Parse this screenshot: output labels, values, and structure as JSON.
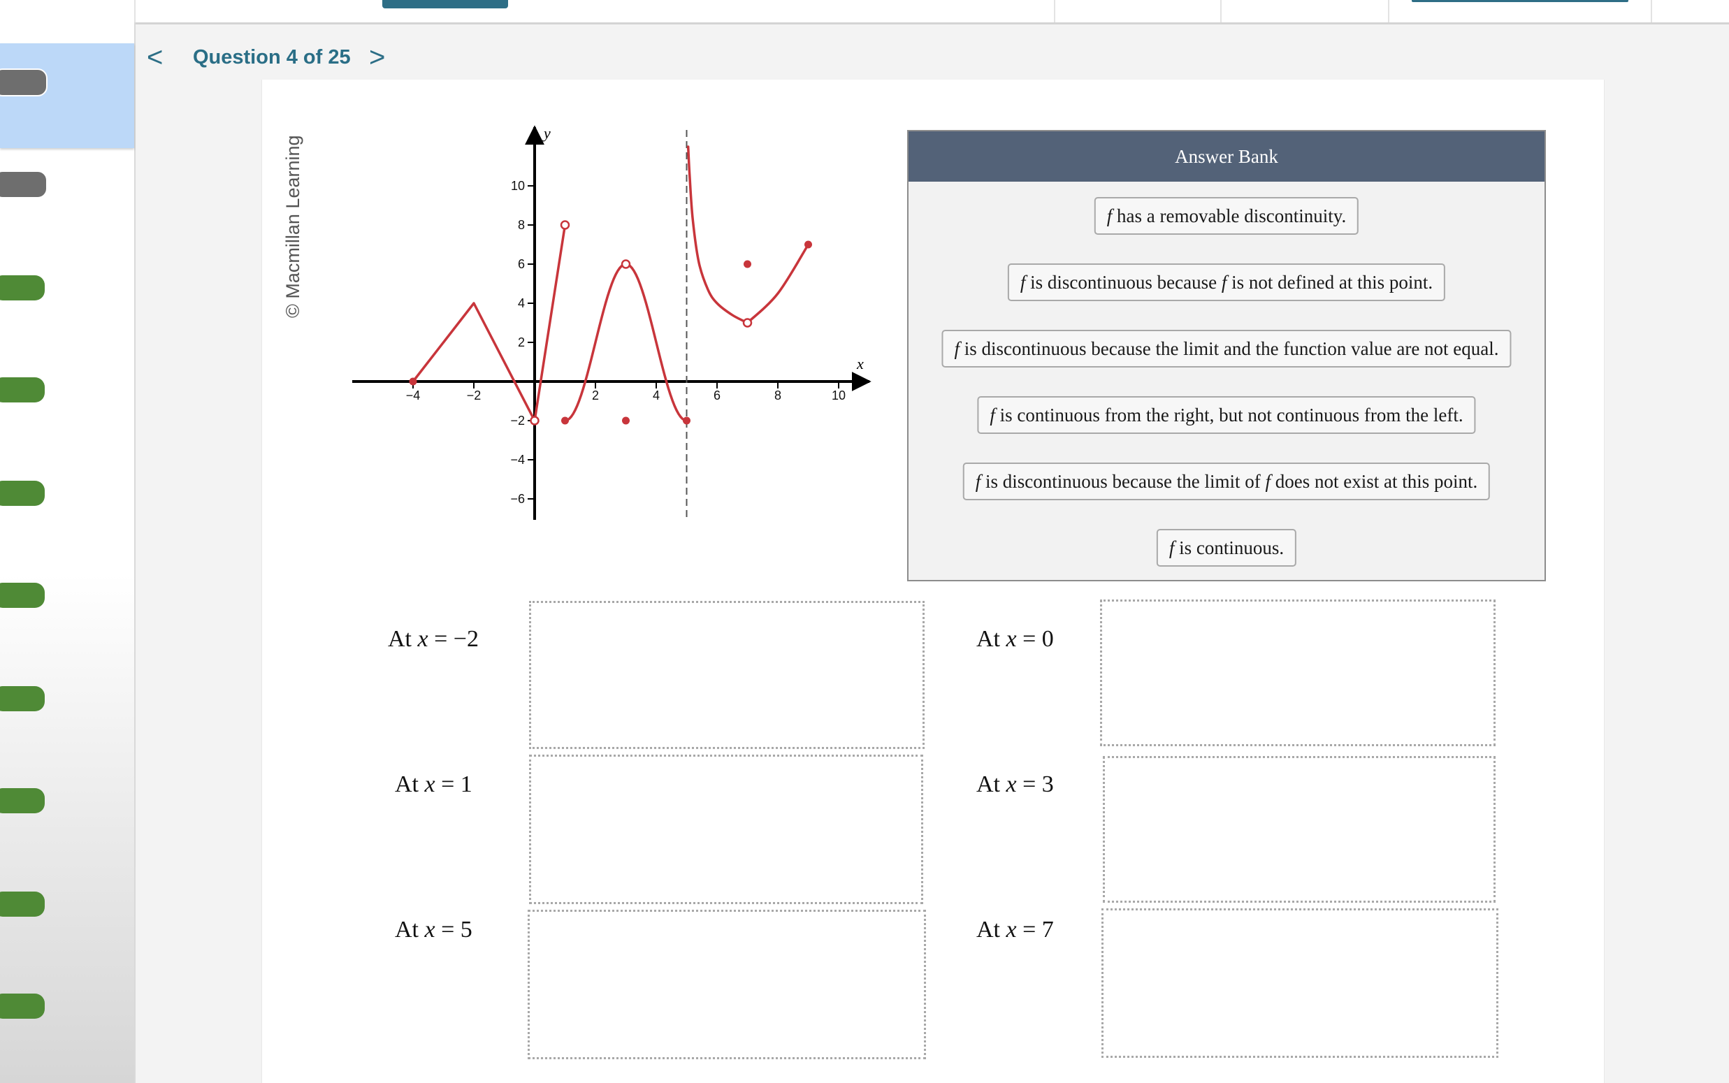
{
  "header": {
    "prev_symbol": "<",
    "next_symbol": ">",
    "question_label": "Question 4 of 25"
  },
  "credit": "© Macmillan Learning",
  "chart_data": {
    "type": "line",
    "title": "",
    "xlabel": "x",
    "ylabel": "y",
    "xlim": [
      -5,
      11
    ],
    "ylim": [
      -7,
      12
    ],
    "x_ticks": [
      -4,
      -2,
      2,
      4,
      6,
      8,
      10
    ],
    "y_ticks": [
      -6,
      -4,
      -2,
      2,
      4,
      6,
      8,
      10
    ],
    "x_tick_labels": [
      "−4",
      "−2",
      "2",
      "4",
      "6",
      "8",
      "10"
    ],
    "y_tick_labels": [
      "−6",
      "−4",
      "−2",
      "2",
      "4",
      "6",
      "8",
      "10"
    ],
    "vertical_asymptote": 5,
    "curve_color": "#c8353b",
    "segments": [
      {
        "x": [
          -4,
          -2,
          0
        ],
        "y": [
          0,
          4,
          -2
        ],
        "shape": "linear"
      },
      {
        "x": [
          0,
          1
        ],
        "y": [
          -2,
          8
        ],
        "shape": "linear"
      },
      {
        "x": [
          1,
          3,
          5
        ],
        "y": [
          -2,
          6,
          -2
        ],
        "shape": "hump"
      },
      {
        "x": [
          5.05,
          5.1,
          5.2,
          5.4,
          5.7,
          6,
          6.5,
          7
        ],
        "y": [
          12,
          10.5,
          8.3,
          6.1,
          4.7,
          4,
          3.4,
          3
        ],
        "shape": "smooth"
      },
      {
        "x": [
          7,
          8,
          9
        ],
        "y": [
          3,
          4.5,
          7
        ],
        "shape": "smooth"
      }
    ],
    "closed_points": [
      [
        -4,
        0
      ],
      [
        1,
        -2
      ],
      [
        3,
        -2
      ],
      [
        5,
        -2
      ],
      [
        7,
        6
      ],
      [
        9,
        7
      ]
    ],
    "open_points": [
      [
        0,
        -2
      ],
      [
        1,
        8
      ],
      [
        3,
        6
      ],
      [
        7,
        3
      ]
    ]
  },
  "answer_bank": {
    "title": "Answer Bank",
    "items": [
      {
        "f1": "f",
        "mid": " has a removable discontinuity.",
        "f2": "",
        "end": ""
      },
      {
        "f1": "f",
        "mid": " is discontinuous because ",
        "f2": "f",
        "end": " is not defined at this point."
      },
      {
        "f1": "f",
        "mid": " is discontinuous because the limit and the function value are not equal.",
        "f2": "",
        "end": ""
      },
      {
        "f1": "f",
        "mid": " is continuous from the right, but not continuous from the left.",
        "f2": "",
        "end": ""
      },
      {
        "f1": "f",
        "mid": " is discontinuous because the limit of ",
        "f2": "f",
        "end": " does not exist at this point."
      },
      {
        "f1": "f",
        "mid": " is continuous.",
        "f2": "",
        "end": ""
      }
    ]
  },
  "targets": [
    {
      "prefix": "At ",
      "var": "x",
      "rest": " = −2"
    },
    {
      "prefix": "At ",
      "var": "x",
      "rest": " = 0"
    },
    {
      "prefix": "At ",
      "var": "x",
      "rest": " = 1"
    },
    {
      "prefix": "At ",
      "var": "x",
      "rest": " = 3"
    },
    {
      "prefix": "At ",
      "var": "x",
      "rest": " = 5"
    },
    {
      "prefix": "At ",
      "var": "x",
      "rest": " = 7"
    }
  ]
}
